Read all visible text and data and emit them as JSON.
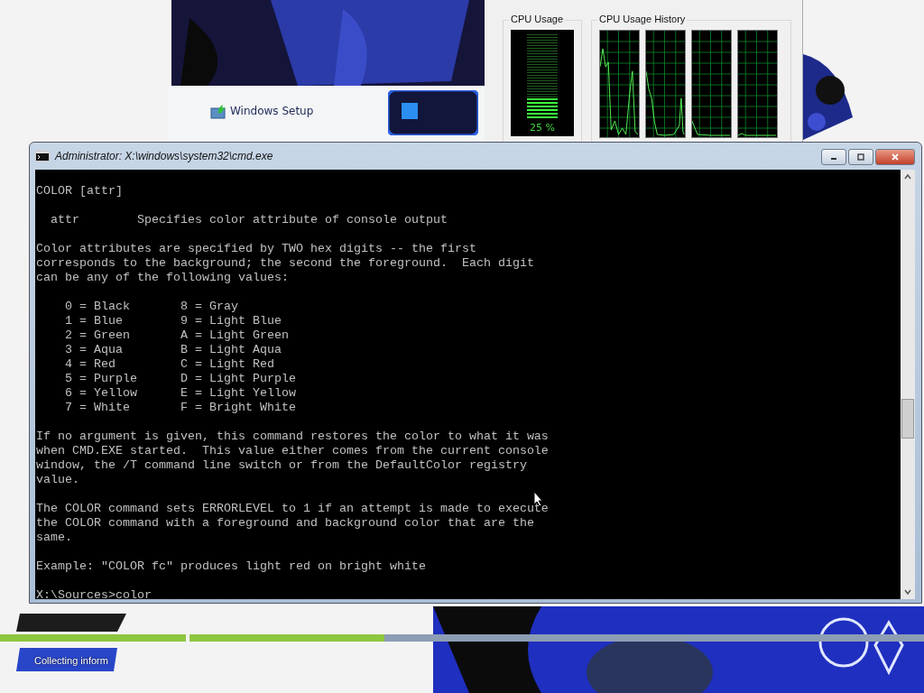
{
  "setup_window": {
    "title": "Windows Setup"
  },
  "task_manager": {
    "cpu_usage": {
      "label": "CPU Usage",
      "level": 0.25,
      "reading": "25 %"
    },
    "cpu_history": {
      "label": "CPU Usage History"
    }
  },
  "console_window": {
    "title": "Administrator: X:\\windows\\system32\\cmd.exe",
    "paragraphs": [
      [
        "COLOR [attr]"
      ],
      [
        "  attr        Specifies color attribute of console output"
      ],
      [
        "Color attributes are specified by TWO hex digits -- the first",
        "corresponds to the background; the second the foreground.  Each digit",
        "can be any of the following values:"
      ],
      [
        "    0 = Black       8 = Gray",
        "    1 = Blue        9 = Light Blue",
        "    2 = Green       A = Light Green",
        "    3 = Aqua        B = Light Aqua",
        "    4 = Red         C = Light Red",
        "    5 = Purple      D = Light Purple",
        "    6 = Yellow      E = Light Yellow",
        "    7 = White       F = Bright White"
      ],
      [
        "If no argument is given, this command restores the color to what it was",
        "when CMD.EXE started.  This value either comes from the current console",
        "window, the /T command line switch or from the DefaultColor registry",
        "value."
      ],
      [
        "The COLOR command sets ERRORLEVEL to 1 if an attempt is made to execute",
        "the COLOR command with a foreground and background color that are the",
        "same."
      ],
      [
        "Example: \"COLOR fc\" produces light red on bright white"
      ],
      [
        "X:\\Sources>color"
      ]
    ]
  },
  "setup_progress": [
    {
      "level": 1
    },
    {
      "level": 0.265
    }
  ],
  "status_text": "Collecting inform"
}
